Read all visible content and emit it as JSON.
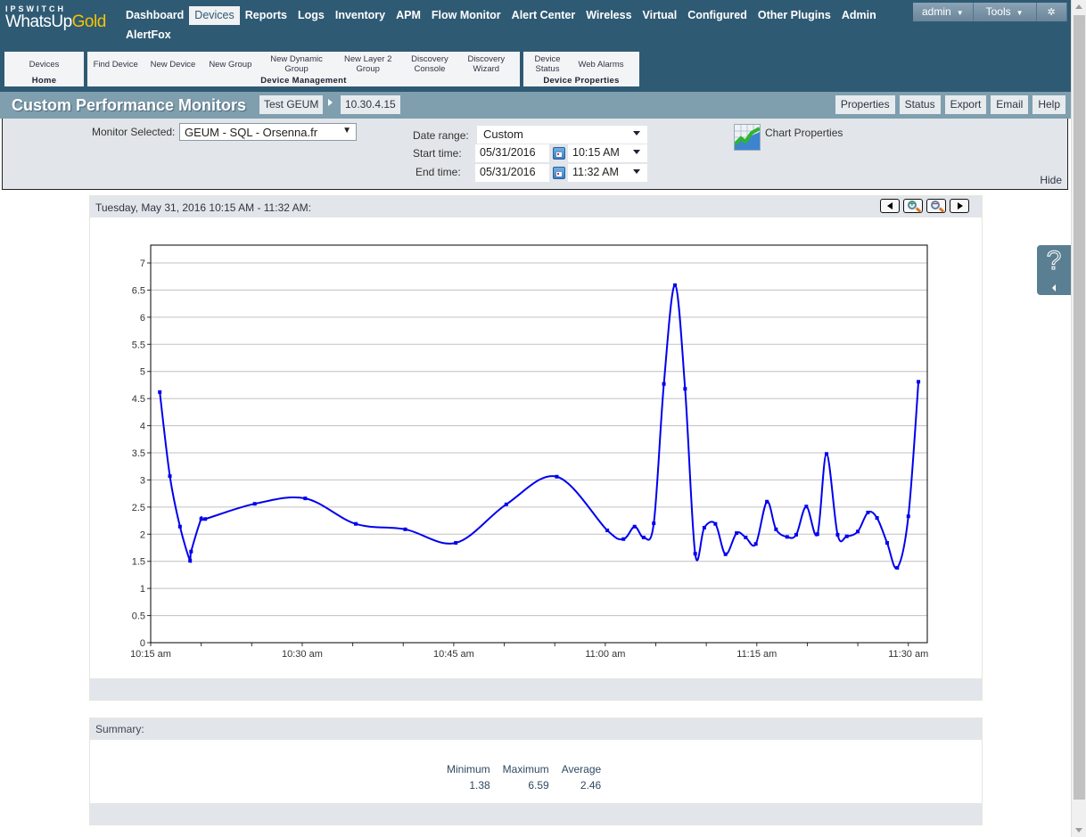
{
  "logo": {
    "top": "IPSWITCH",
    "main_a": "WhatsUp",
    "main_b": "Gold"
  },
  "nav": {
    "items": [
      "Dashboard",
      "Devices",
      "Reports",
      "Logs",
      "Inventory",
      "APM",
      "Flow Monitor",
      "Alert Center",
      "Wireless",
      "Virtual",
      "Configured",
      "Other Plugins",
      "Admin",
      "AlertFox"
    ],
    "active": "Devices"
  },
  "user": {
    "name": "admin",
    "tools": "Tools",
    "settings_icon": "gear-icon"
  },
  "subnav": {
    "home": {
      "items": [
        "Devices"
      ],
      "label": "Home"
    },
    "management": {
      "items": [
        "Find Device",
        "New Device",
        "New Group",
        "New Dynamic Group",
        "New Layer 2 Group",
        "Discovery Console",
        "Discovery Wizard"
      ],
      "label": "Device Management"
    },
    "properties": {
      "items": [
        "Device Status",
        "Web Alarms"
      ],
      "label": "Device Properties"
    }
  },
  "page": {
    "title": "Custom Performance Monitors",
    "breadcrumb": [
      "Test GEUM",
      "10.30.4.15"
    ],
    "buttons": [
      "Properties",
      "Status",
      "Export",
      "Email",
      "Help"
    ]
  },
  "filters": {
    "monitor_label": "Monitor Selected:",
    "monitor_value": "GEUM - SQL - Orsenna.fr",
    "date_range_label": "Date range:",
    "date_range_value": "Custom",
    "start_label": "Start time:",
    "start_date": "05/31/2016",
    "start_time": "10:15 AM",
    "end_label": "End time:",
    "end_date": "05/31/2016",
    "end_time": "11:32 AM",
    "chart_properties": "Chart Properties",
    "hide": "Hide"
  },
  "chart_panel": {
    "header": "Tuesday, May 31, 2016 10:15 AM - 11:32 AM:"
  },
  "chart_data": {
    "type": "line",
    "title": "",
    "xlabel": "",
    "ylabel": "",
    "x_unit": "minutes after 10:15 am",
    "xlim": [
      0,
      77
    ],
    "ylim": [
      0,
      7.3
    ],
    "yticks": [
      0,
      0.5,
      1,
      1.5,
      2,
      2.5,
      3,
      3.5,
      4,
      4.5,
      5,
      5.5,
      6,
      6.5,
      7
    ],
    "ytick_labels": [
      "0",
      "0.5",
      "1",
      "1.5",
      "2",
      "2.5",
      "3",
      "3.5",
      "4",
      "4.5",
      "5",
      "5.5",
      "6",
      "6.5",
      "7"
    ],
    "xticks": [
      0,
      5,
      10,
      15,
      20,
      25,
      30,
      35,
      40,
      45,
      50,
      55,
      60,
      65,
      70,
      75
    ],
    "xtick_labels": [
      "10:15 am",
      "",
      "",
      "10:30 am",
      "",
      "",
      "10:45 am",
      "",
      "",
      "11:00 am",
      "",
      "",
      "11:15 am",
      "",
      "",
      "11:30 am"
    ],
    "grid": true,
    "legend": "none",
    "series": [
      {
        "name": "GEUM - SQL - Orsenna.fr",
        "color": "#0000ee",
        "x": [
          0.9,
          1.9,
          2.9,
          3.9,
          4.0,
          5.0,
          5.4,
          10.3,
          15.3,
          20.3,
          25.2,
          30.2,
          35.2,
          40.2,
          45.2,
          46.8,
          47.9,
          48.8,
          49.8,
          50.8,
          51.9,
          52.9,
          53.9,
          54.8,
          55.9,
          56.9,
          58.0,
          58.9,
          59.9,
          61.0,
          61.9,
          63.0,
          63.9,
          64.9,
          66.0,
          66.9,
          68.0,
          68.9,
          70.0,
          71.0,
          71.9,
          72.9,
          73.9,
          75.0,
          76.0
        ],
        "values": [
          4.62,
          3.07,
          2.14,
          1.51,
          1.68,
          2.28,
          2.28,
          2.56,
          2.66,
          2.19,
          2.09,
          1.84,
          2.55,
          3.06,
          2.07,
          1.91,
          2.14,
          1.94,
          2.2,
          4.77,
          6.59,
          4.68,
          1.64,
          2.12,
          2.19,
          1.63,
          2.02,
          1.94,
          1.82,
          2.6,
          2.09,
          1.95,
          1.99,
          2.51,
          2.0,
          3.48,
          1.99,
          1.96,
          2.05,
          2.4,
          2.3,
          1.84,
          1.38,
          2.33,
          4.81
        ]
      }
    ]
  },
  "summary": {
    "header": "Summary:",
    "columns": [
      {
        "label": "Minimum",
        "value": "1.38"
      },
      {
        "label": "Maximum",
        "value": "6.59"
      },
      {
        "label": "Average",
        "value": "2.46"
      }
    ]
  }
}
